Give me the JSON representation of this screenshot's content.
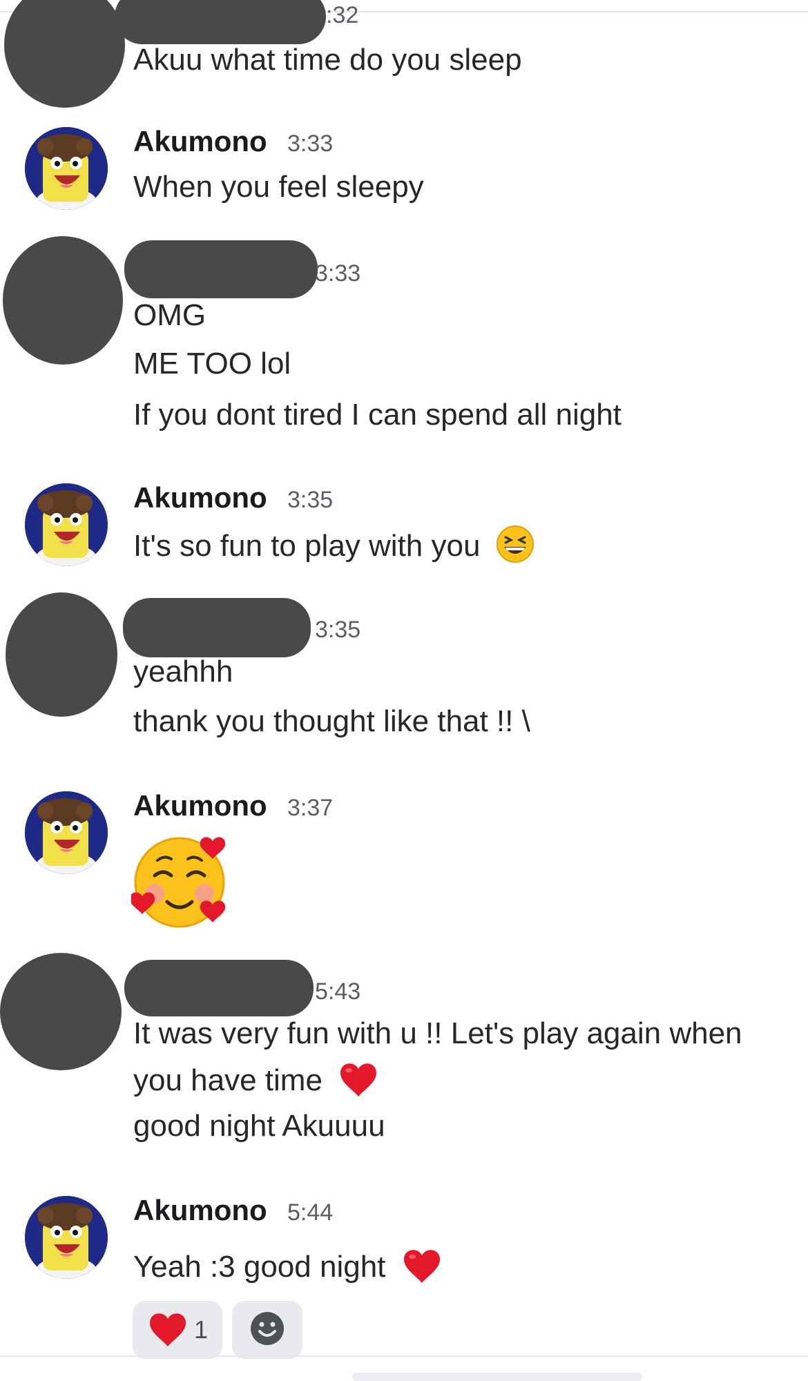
{
  "messages": [
    {
      "author": "",
      "time": ":32",
      "lines": [
        "Akuu what time do you sleep"
      ]
    },
    {
      "author": "Akumono",
      "time": "3:33",
      "lines": [
        "When you feel sleepy"
      ]
    },
    {
      "author": "",
      "time": "3:33",
      "lines": [
        "OMG",
        "ME TOO lol",
        "If you dont tired I can spend all night"
      ]
    },
    {
      "author": "Akumono",
      "time": "3:35",
      "lines": [
        "It's so fun to play with you"
      ]
    },
    {
      "author": "",
      "time": "3:35",
      "lines": [
        "yeahhh",
        "thank you thought like that !! \\"
      ]
    },
    {
      "author": "Akumono",
      "time": "3:37",
      "lines": []
    },
    {
      "author": "",
      "time": "5:43",
      "lines": [
        "It was very fun with u !! Let's play again when",
        "you have time",
        "good night Akuuuu"
      ]
    },
    {
      "author": "Akumono",
      "time": "5:44",
      "lines": [
        "Yeah :3 good night"
      ]
    }
  ],
  "reactions": [
    {
      "icon": "red-heart-icon",
      "count": "1"
    },
    {
      "icon": "add-reaction-icon",
      "count": ""
    }
  ],
  "colors": {
    "redaction": "#494949",
    "heart": "#e3192b",
    "reaction_bg": "#e9eaed",
    "timestamp": "#5c5e66"
  }
}
